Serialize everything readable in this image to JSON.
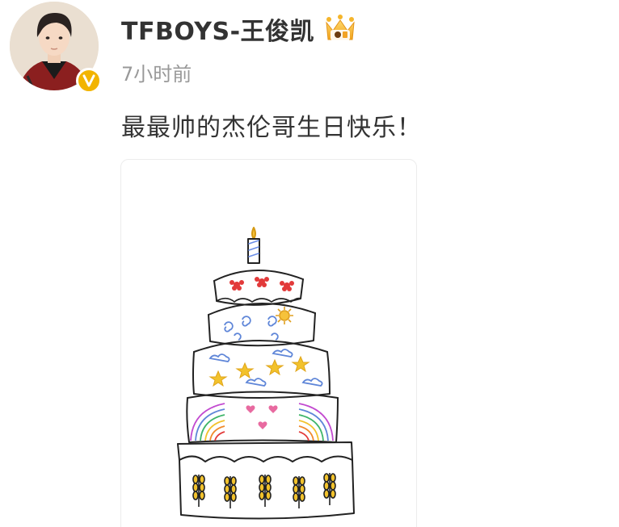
{
  "post": {
    "author": {
      "name": "TFBOYS-王俊凯",
      "verified": true,
      "verified_color": "#f2b400",
      "avatar_icon": "user-avatar",
      "badge_icon": "vip-crown-icon"
    },
    "timestamp": "7小时前",
    "text": "最最帅的杰伦哥生日快乐！",
    "image": {
      "subject": "hand-drawn-birthday-cake"
    }
  }
}
